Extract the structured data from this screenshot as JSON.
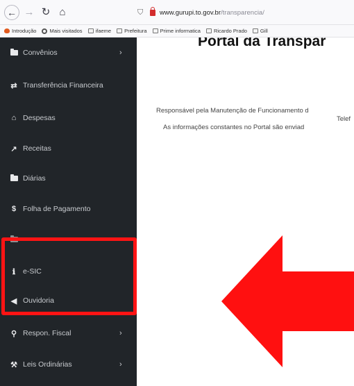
{
  "browser": {
    "url_domain": "www.gurupi.to.gov.br",
    "url_path": "/transparencia/",
    "bookmarks": [
      {
        "icon": "fire-icon",
        "label": "Introdução"
      },
      {
        "icon": "gear-icon",
        "label": "Mais visitados"
      },
      {
        "icon": "folder-icon",
        "label": "ifaeme"
      },
      {
        "icon": "folder-icon",
        "label": "Prefeitura"
      },
      {
        "icon": "folder-icon",
        "label": "Prime informatica"
      },
      {
        "icon": "folder-icon",
        "label": "Ricardo Prado"
      },
      {
        "icon": "folder-icon",
        "label": "Gill"
      }
    ]
  },
  "sidebar": {
    "items": [
      {
        "label": "Convênios",
        "icon": "folder-icon",
        "chevron": true
      },
      {
        "label": "Transferência Financeira",
        "icon": "transfer-icon",
        "chevron": false
      },
      {
        "label": "Despesas",
        "icon": "bank-icon",
        "chevron": false
      },
      {
        "label": "Receitas",
        "icon": "chart-icon",
        "chevron": false
      },
      {
        "label": "Diárias",
        "icon": "folder-icon",
        "chevron": false
      },
      {
        "label": "Folha de Pagamento",
        "icon": "dollar-icon",
        "chevron": false
      },
      {
        "label": "",
        "icon": "folder-icon",
        "chevron": true
      },
      {
        "label": "e-SIC",
        "icon": "info-icon",
        "chevron": false
      },
      {
        "label": "Ouvidoria",
        "icon": "megaphone-icon",
        "chevron": false
      },
      {
        "label": "Respon. Fiscal",
        "icon": "search-icon",
        "chevron": true
      },
      {
        "label": "Leis Ordinárias",
        "icon": "gavel-icon",
        "chevron": true
      }
    ]
  },
  "main": {
    "title": "Portal da Transpar",
    "lines": [
      "Responsável pela Manutenção de Funcionamento d",
      "Telef",
      "As informações constantes no Portal são enviad"
    ]
  },
  "annotation": {
    "highlight_color": "#ff1414",
    "arrow_color": "#ff1010"
  }
}
